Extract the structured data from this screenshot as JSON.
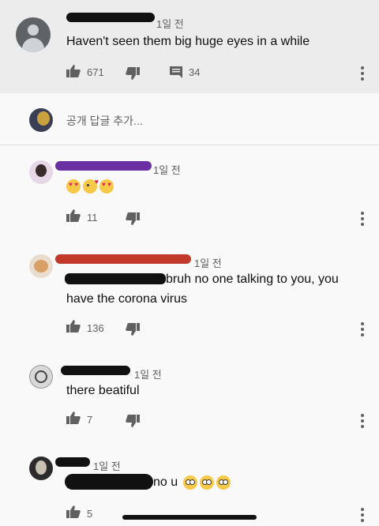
{
  "parent": {
    "time": "1일 전",
    "text": "Haven't seen them big huge eyes in a while",
    "likes": "671",
    "replies": "34"
  },
  "add_reply": {
    "placeholder": "공개 답글 추가..."
  },
  "replies": [
    {
      "time": "1일 전",
      "text": "",
      "emojis": [
        "heart-eyes",
        "kiss",
        "hearts"
      ],
      "likes": "11"
    },
    {
      "time": "1일 전",
      "text_a": "bruh no one talking to you, you",
      "text_b": "have the corona virus",
      "likes": "136"
    },
    {
      "time": "1일 전",
      "text": "there beatiful",
      "likes": "7"
    },
    {
      "time": "1일 전",
      "text": "no u",
      "emojis": [
        "flushed",
        "flushed",
        "flushed"
      ],
      "likes": "5"
    }
  ],
  "colors": {
    "parent_bg": "#ececec",
    "page_bg": "#f9f9f9",
    "muted": "#606060"
  }
}
